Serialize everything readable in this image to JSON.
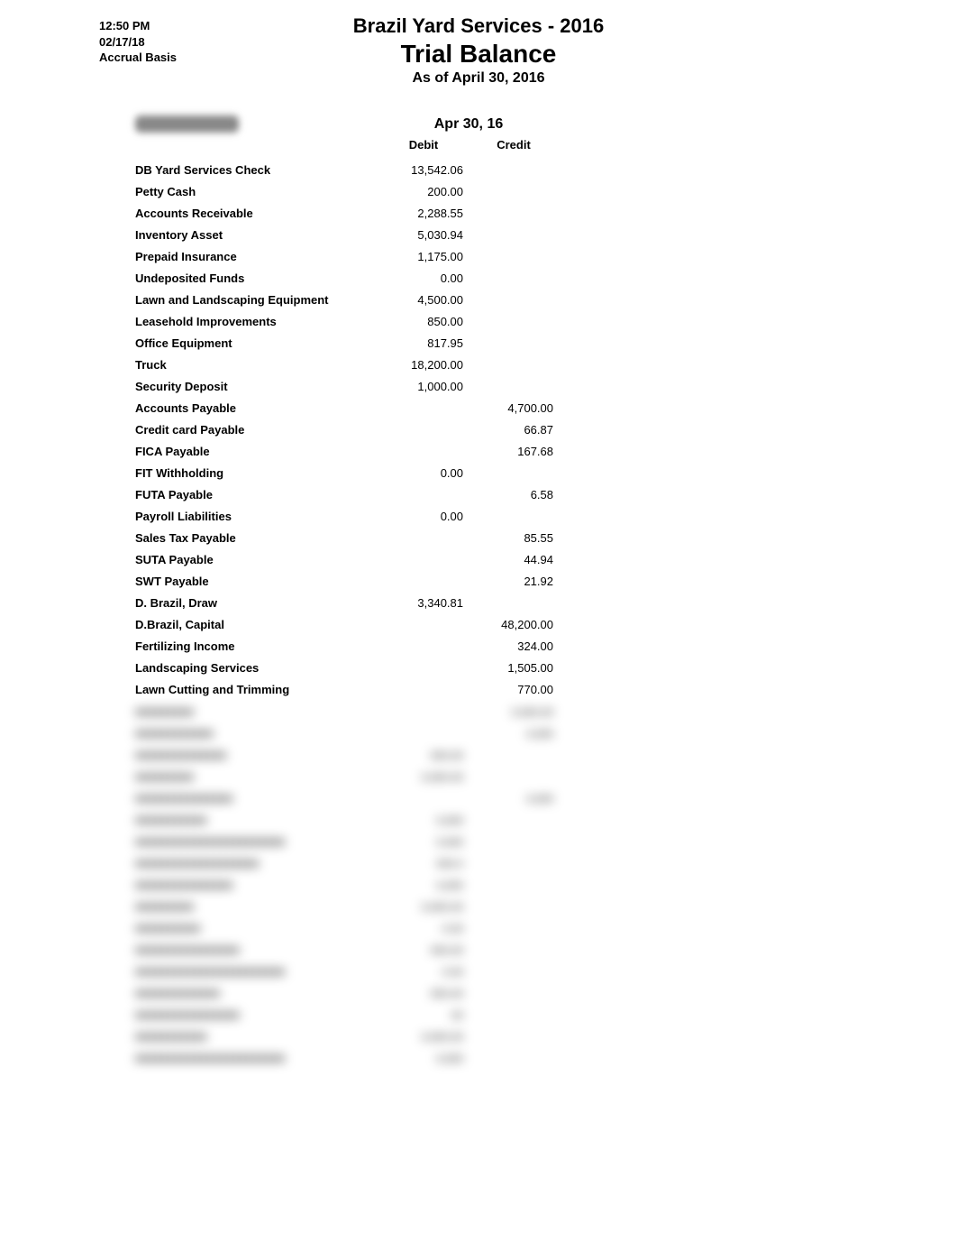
{
  "header": {
    "time": "12:50 PM",
    "date": "02/17/18",
    "basis": "Accrual Basis",
    "company": "Brazil Yard Services - 2016",
    "report": "Trial Balance",
    "asof": "As of April 30, 2016"
  },
  "columns": {
    "group": "Apr 30, 16",
    "debit": "Debit",
    "credit": "Credit"
  },
  "first_row_blurred_placeholder": "xxxxxxxxxxxx",
  "rows": [
    {
      "acct": "DB Yard Services Check",
      "debit": "13,542.06",
      "credit": "",
      "blurred": false
    },
    {
      "acct": "Petty Cash",
      "debit": "200.00",
      "credit": "",
      "blurred": false
    },
    {
      "acct": "Accounts Receivable",
      "debit": "2,288.55",
      "credit": "",
      "blurred": false
    },
    {
      "acct": "Inventory Asset",
      "debit": "5,030.94",
      "credit": "",
      "blurred": false
    },
    {
      "acct": "Prepaid Insurance",
      "debit": "1,175.00",
      "credit": "",
      "blurred": false
    },
    {
      "acct": "Undeposited Funds",
      "debit": "0.00",
      "credit": "",
      "blurred": false
    },
    {
      "acct": "Lawn and Landscaping Equipment",
      "debit": "4,500.00",
      "credit": "",
      "blurred": false
    },
    {
      "acct": "Leasehold Improvements",
      "debit": "850.00",
      "credit": "",
      "blurred": false
    },
    {
      "acct": "Office Equipment",
      "debit": "817.95",
      "credit": "",
      "blurred": false
    },
    {
      "acct": "Truck",
      "debit": "18,200.00",
      "credit": "",
      "blurred": false
    },
    {
      "acct": "Security Deposit",
      "debit": "1,000.00",
      "credit": "",
      "blurred": false
    },
    {
      "acct": "Accounts Payable",
      "debit": "",
      "credit": "4,700.00",
      "blurred": false
    },
    {
      "acct": "Credit card Payable",
      "debit": "",
      "credit": "66.87",
      "blurred": false
    },
    {
      "acct": "FICA Payable",
      "debit": "",
      "credit": "167.68",
      "blurred": false
    },
    {
      "acct": "FIT Withholding",
      "debit": "0.00",
      "credit": "",
      "blurred": false
    },
    {
      "acct": "FUTA Payable",
      "debit": "",
      "credit": "6.58",
      "blurred": false
    },
    {
      "acct": "Payroll Liabilities",
      "debit": "0.00",
      "credit": "",
      "blurred": false
    },
    {
      "acct": "Sales Tax Payable",
      "debit": "",
      "credit": "85.55",
      "blurred": false
    },
    {
      "acct": "SUTA Payable",
      "debit": "",
      "credit": "44.94",
      "blurred": false
    },
    {
      "acct": "SWT Payable",
      "debit": "",
      "credit": "21.92",
      "blurred": false
    },
    {
      "acct": "D. Brazil, Draw",
      "debit": "3,340.81",
      "credit": "",
      "blurred": false
    },
    {
      "acct": "D.Brazil, Capital",
      "debit": "",
      "credit": "48,200.00",
      "blurred": false
    },
    {
      "acct": "Fertilizing Income",
      "debit": "",
      "credit": "324.00",
      "blurred": false
    },
    {
      "acct": "Landscaping Services",
      "debit": "",
      "credit": "1,505.00",
      "blurred": false
    },
    {
      "acct": "Lawn Cutting and Trimming",
      "debit": "",
      "credit": "770.00",
      "blurred": false
    },
    {
      "acct": "xxxxxxxxx",
      "debit": "",
      "credit": "x,xxx.xx",
      "blurred": true
    },
    {
      "acct": "xxxxxxxxxxxx",
      "debit": "",
      "credit": "x,xxx",
      "blurred": true
    },
    {
      "acct": "xxxxxxxxxxxxxx",
      "debit": "xxx.xx",
      "credit": "",
      "blurred": true
    },
    {
      "acct": "xxxxxxxxx",
      "debit": "x,xxx.xx",
      "credit": "",
      "blurred": true
    },
    {
      "acct": "xxxxxxxxxxxxxxx",
      "debit": "",
      "credit": "x,xxx",
      "blurred": true
    },
    {
      "acct": "xxxxxxxxxxx",
      "debit": "x,xxx",
      "credit": "",
      "blurred": true
    },
    {
      "acct": "xxxxxxxxxxxxxxxxxxxxxxx",
      "debit": "x,xxx",
      "credit": "",
      "blurred": true
    },
    {
      "acct": "xxxxxxxxxxxxxxxxxxx",
      "debit": "xxx.x",
      "credit": "",
      "blurred": true
    },
    {
      "acct": "xxxxxxxxxxxxxxx",
      "debit": "x,xxx",
      "credit": "",
      "blurred": true
    },
    {
      "acct": "xxxxxxxxx",
      "debit": "x,xxx.xx",
      "credit": "",
      "blurred": true
    },
    {
      "acct": "xxxxxxxxxx",
      "debit": "x.xx",
      "credit": "",
      "blurred": true
    },
    {
      "acct": "xxxxxxxxxxxxxxxx",
      "debit": "xxx.xx",
      "credit": "",
      "blurred": true
    },
    {
      "acct": "xxxxxxxxxxxxxxxxxxxxxxx",
      "debit": "x.xx",
      "credit": "",
      "blurred": true
    },
    {
      "acct": "xxxxxxxxxxxxx",
      "debit": "xxx.xx",
      "credit": "",
      "blurred": true
    },
    {
      "acct": "xxxxxxxxxxxxxxxx",
      "debit": "xx",
      "credit": "",
      "blurred": true
    },
    {
      "acct": "xxxxxxxxxxx",
      "debit": "x,xxx.xx",
      "credit": "",
      "blurred": true
    },
    {
      "acct": "xxxxxxxxxxxxxxxxxxxxxxx",
      "debit": "x,xxx",
      "credit": "",
      "blurred": true
    }
  ]
}
